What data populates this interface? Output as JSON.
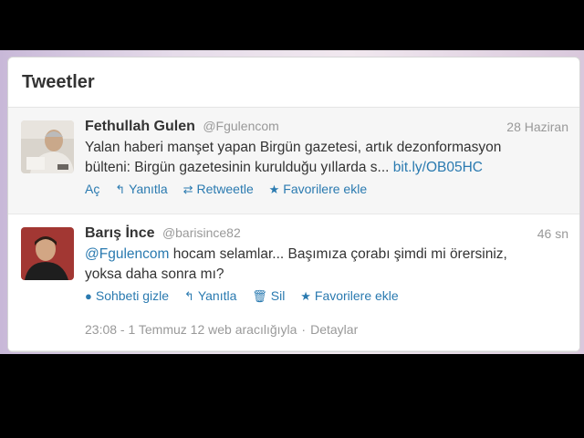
{
  "panel": {
    "title": "Tweetler"
  },
  "tweets": [
    {
      "name": "Fethullah Gulen",
      "handle": "@Fgulencom",
      "time": "28 Haziran",
      "text_line1": "Yalan haberi manşet yapan Birgün gazetesi, artık dezonformasyon",
      "text_line2": "bülteni: Birgün gazetesinin kurulduğu yıllarda s...",
      "link": "bit.ly/OB05HC",
      "actions": {
        "expand": "Aç",
        "reply": "Yanıtla",
        "retweet": "Retweetle",
        "favorite": "Favorilere ekle"
      }
    },
    {
      "name": "Barış İnce",
      "handle": "@barisince82",
      "time": "46 sn",
      "mention": "@Fgulencom",
      "text_line1_rest": "hocam selamlar... Başımıza çorabı şimdi mi örersiniz,",
      "text_line2": "yoksa daha sonra mı?",
      "actions": {
        "hide": "Sohbeti gizle",
        "reply": "Yanıtla",
        "delete": "Sil",
        "favorite": "Favorilere ekle"
      },
      "meta": {
        "timestamp": "23:08 - 1 Temmuz 12 web aracılığıyla",
        "separator": "·",
        "details": "Detaylar"
      }
    }
  ],
  "colors": {
    "link": "#2a7ab0",
    "muted": "#999999",
    "text": "#333333"
  }
}
